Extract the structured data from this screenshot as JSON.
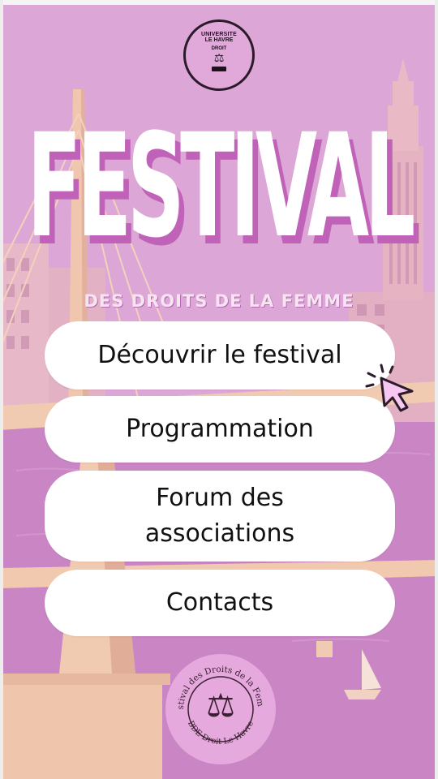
{
  "university_seal": {
    "line1": "UNIVERSITE",
    "line2": "LE HAVRE",
    "line3": "DROIT",
    "banner": "",
    "icon": "scales-of-justice-icon"
  },
  "title": "FESTIVAL",
  "subtitle": "DES DROITS DE LA FEMME",
  "menu": [
    {
      "label": "Découvrir le festival"
    },
    {
      "label": "Programmation"
    },
    {
      "label": "Forum des associations"
    },
    {
      "label": "Contacts"
    }
  ],
  "cursor_icon": "pointer-click-icon",
  "bde_seal": {
    "top_text": "Festival des Droits de la Femme",
    "bottom_text": "BDE Droit Le Havre",
    "icon": "scales-of-justice-icon"
  },
  "colors": {
    "background": "#d9a2d2",
    "title_shadow": "#c062b8",
    "button": "#ffffff",
    "seal": "#e5a9de"
  }
}
